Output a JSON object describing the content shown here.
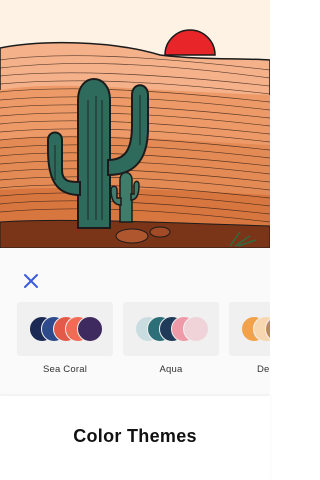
{
  "close": {
    "icon": "close-x-icon",
    "color": "#3b5bdb"
  },
  "themes": [
    {
      "name": "Sea Coral",
      "colors": [
        "#1b2a55",
        "#2c4a8c",
        "#e45a48",
        "#f36a55",
        "#3e2a5e"
      ]
    },
    {
      "name": "Aqua",
      "colors": [
        "#c9dde1",
        "#2d6f78",
        "#203a5a",
        "#ee9aa8",
        "#efd3d8"
      ]
    },
    {
      "name": "De",
      "colors": [
        "#f2a24a",
        "#f6d7b0",
        "#b98a5c",
        "#ddd3c3",
        "#c7c7c7"
      ]
    }
  ],
  "footer": {
    "title": "Color Themes"
  },
  "artwork": {
    "sun_color": "#e8262a",
    "sky_color": "#fdf2e4",
    "cactus_color": "#2f6b5c",
    "sand_color": "#e48a55"
  }
}
